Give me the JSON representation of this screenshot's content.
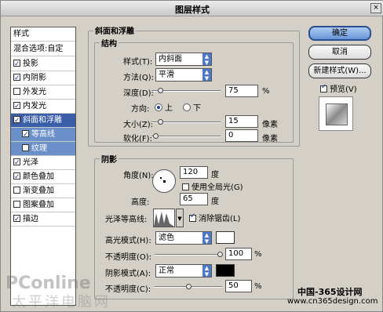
{
  "window": {
    "title": "图层样式",
    "close": "×"
  },
  "sidebar": {
    "items": [
      {
        "label": "样式",
        "checked": null
      },
      {
        "label": "混合选项:自定",
        "checked": null
      },
      {
        "label": "投影",
        "checked": true
      },
      {
        "label": "内阴影",
        "checked": true
      },
      {
        "label": "外发光",
        "checked": false
      },
      {
        "label": "内发光",
        "checked": true
      },
      {
        "label": "斜面和浮雕",
        "checked": true
      },
      {
        "label": "等高线",
        "checked": true
      },
      {
        "label": "纹理",
        "checked": false
      },
      {
        "label": "光泽",
        "checked": true
      },
      {
        "label": "颜色叠加",
        "checked": true
      },
      {
        "label": "渐变叠加",
        "checked": false
      },
      {
        "label": "图案叠加",
        "checked": false
      },
      {
        "label": "描边",
        "checked": true
      }
    ]
  },
  "bevel": {
    "title": "斜面和浮雕",
    "structure_title": "结构",
    "style_label": "样式(T):",
    "style_value": "内斜面",
    "technique_label": "方法(Q):",
    "technique_value": "平滑",
    "depth_label": "深度(D):",
    "depth_value": "75",
    "depth_unit": "%",
    "direction_label": "方向:",
    "dir_up": "上",
    "dir_down": "下",
    "size_label": "大小(Z):",
    "size_value": "15",
    "size_unit": "像素",
    "soften_label": "软化(F):",
    "soften_value": "0",
    "soften_unit": "像素"
  },
  "shading": {
    "title": "阴影",
    "angle_label": "角度(N):",
    "angle_value": "120",
    "angle_unit": "度",
    "global_light": "使用全局光(G)",
    "altitude_label": "高度:",
    "altitude_value": "65",
    "altitude_unit": "度",
    "gloss_label": "光泽等高线:",
    "antialias": "消除锯齿(L)",
    "highlight_mode_label": "高光模式(H):",
    "highlight_mode_value": "滤色",
    "highlight_opacity_label": "不透明度(O):",
    "highlight_opacity_value": "100",
    "pct": "%",
    "shadow_mode_label": "阴影模式(A):",
    "shadow_mode_value": "正常",
    "shadow_opacity_label": "不透明度(C):",
    "shadow_opacity_value": "50"
  },
  "buttons": {
    "ok": "确定",
    "cancel": "取消",
    "new_style": "新建样式(W)...",
    "preview": "预览(V)"
  },
  "watermark": {
    "brand": "PConline",
    "brand_sub": "太平洋电脑网",
    "site_cn": "中国-365设计网",
    "site_url": "www.cn365design.com"
  },
  "colors": {
    "highlight": "#ffffff",
    "shadow": "#000000",
    "accent": "#3a5fa8"
  }
}
